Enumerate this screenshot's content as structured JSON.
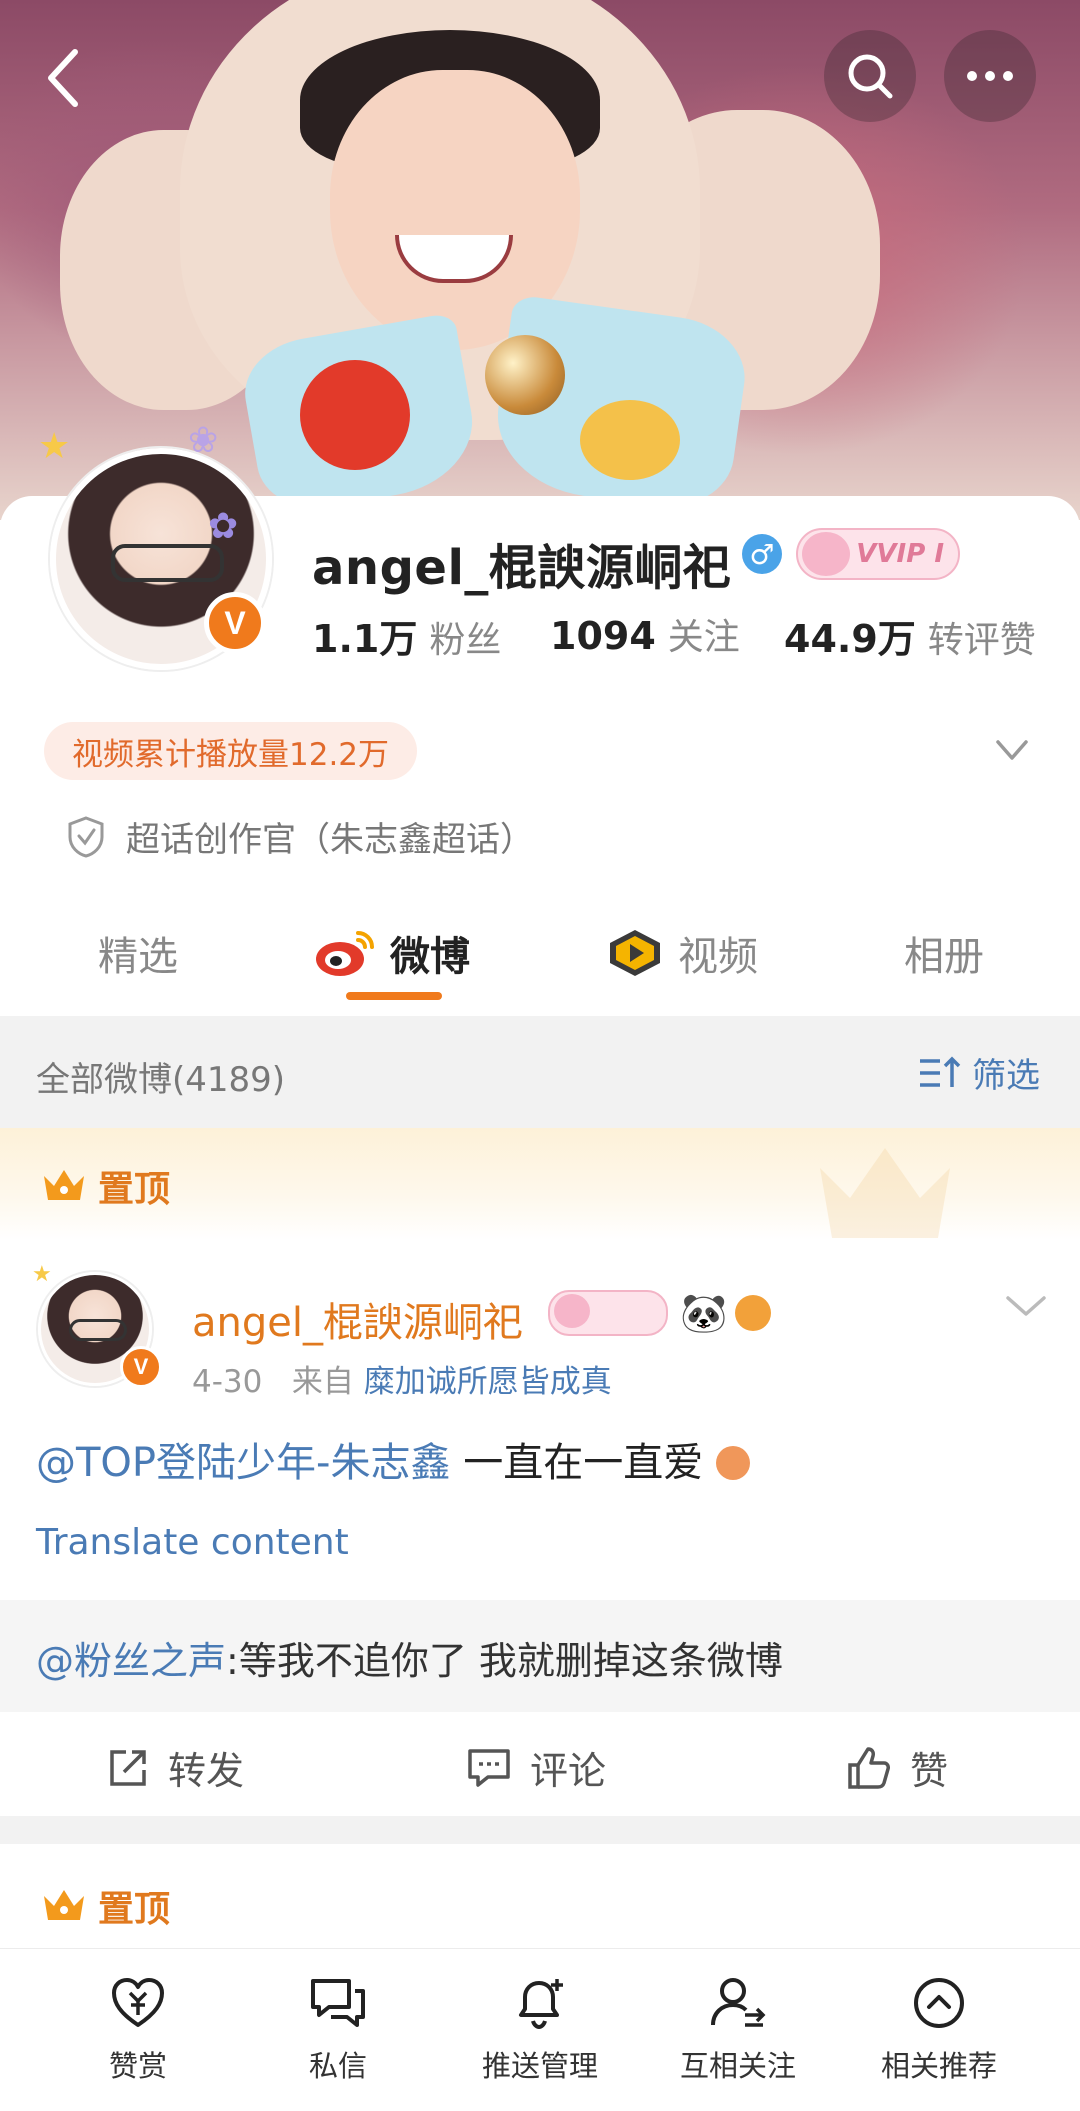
{
  "profile": {
    "name": "angel_棍諛源峒祀",
    "gender_symbol": "♂",
    "vip_label": "VVIP I",
    "verified_badge": "V",
    "stats": [
      {
        "value": "1.1万",
        "label": "粉丝"
      },
      {
        "value": "1094",
        "label": "关注"
      },
      {
        "value": "44.9万",
        "label": "转评赞"
      }
    ],
    "plays_pill": "视频累计播放量12.2万",
    "topic_title": "超话创作官（朱志鑫超话）"
  },
  "tabs": [
    {
      "label": "精选",
      "active": false
    },
    {
      "label": "微博",
      "active": true
    },
    {
      "label": "视频",
      "active": false
    },
    {
      "label": "相册",
      "active": false
    }
  ],
  "filter_bar": {
    "all_posts": "全部微博(4189)",
    "filter_label": "筛选"
  },
  "pinned_label": "置顶",
  "post": {
    "author": "angel_棍諛源峒祀",
    "date": "4-30",
    "source_prefix": "来自",
    "source": "糜加诚所愿皆成真",
    "mention": "@TOP登陆少年-朱志鑫",
    "text": " 一直在一直爱",
    "translate": "Translate content",
    "quote_mention": "@粉丝之声",
    "quote_text": ":等我不追你了 我就删掉这条微博",
    "actions": {
      "repost": "转发",
      "comment": "评论",
      "like": "赞"
    }
  },
  "bottom_bar": [
    {
      "label": "赞赏",
      "icon": "reward-heart-icon"
    },
    {
      "label": "私信",
      "icon": "message-icon"
    },
    {
      "label": "推送管理",
      "icon": "bell-plus-icon"
    },
    {
      "label": "互相关注",
      "icon": "mutual-follow-icon"
    },
    {
      "label": "相关推荐",
      "icon": "chevron-up-circle-icon"
    }
  ],
  "colors": {
    "accent": "#f07a1c",
    "link": "#4a7bb5",
    "pinned": "#e0791e"
  }
}
